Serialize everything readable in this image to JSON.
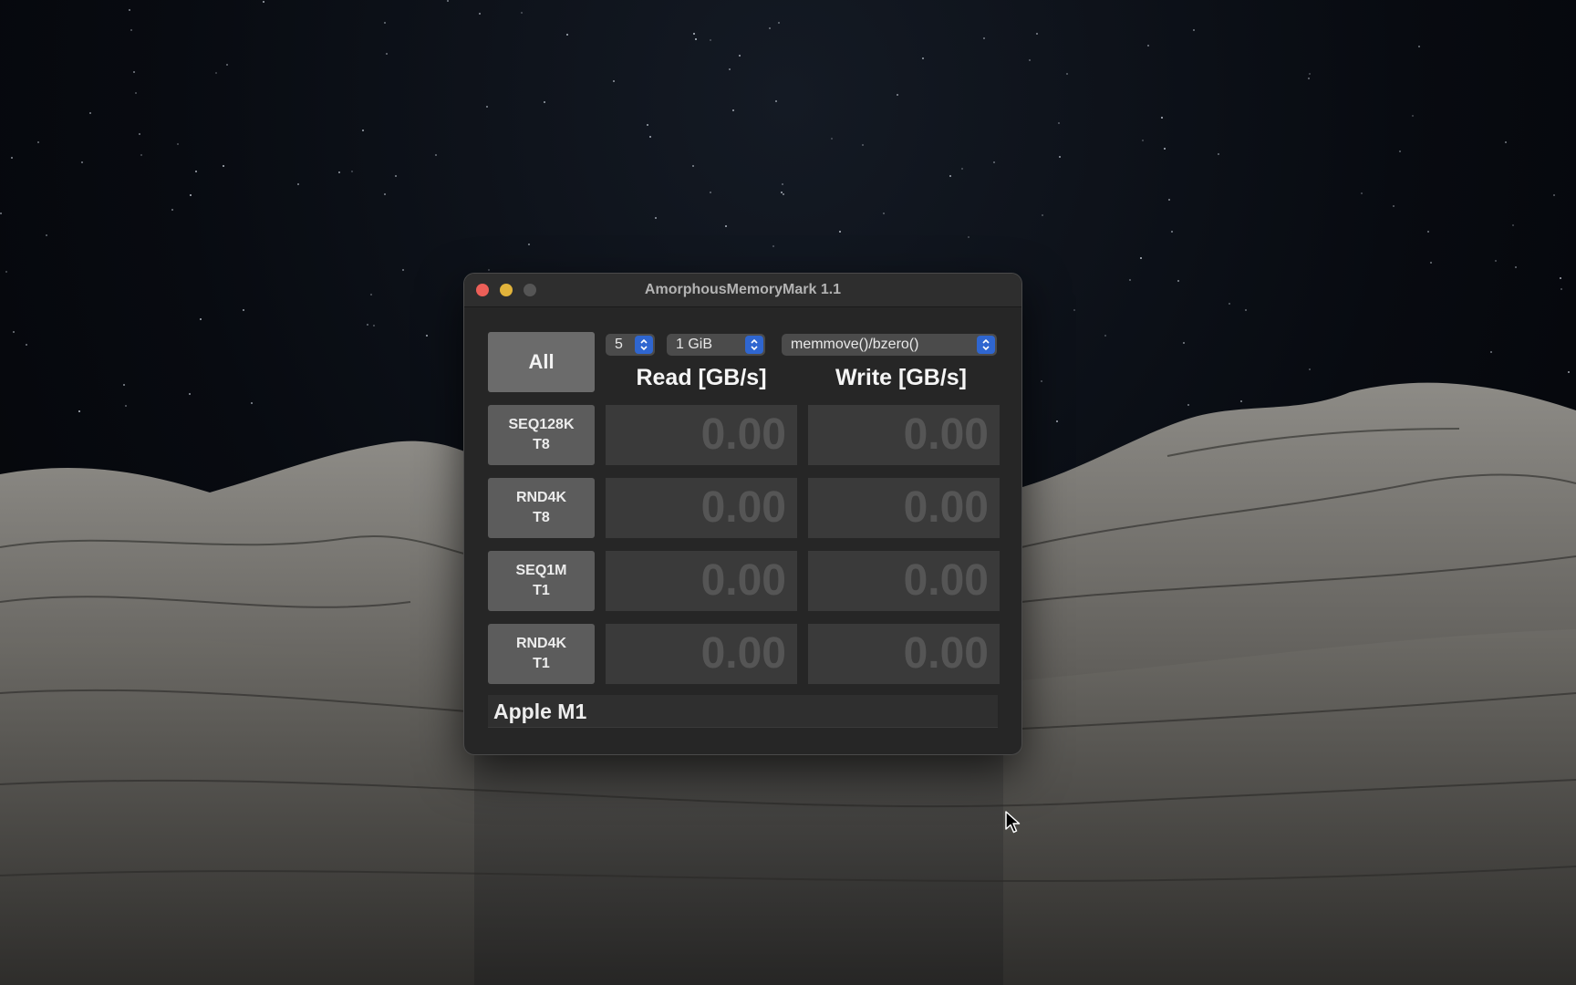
{
  "window": {
    "title": "AmorphousMemoryMark 1.1"
  },
  "controls": {
    "all_button": "All",
    "count_select": "5",
    "size_select": "1 GiB",
    "method_select": "memmove()/bzero()"
  },
  "table": {
    "headers": {
      "read": "Read [GB/s]",
      "write": "Write [GB/s]"
    },
    "rows": [
      {
        "line1": "SEQ128K",
        "line2": "T8",
        "read": "0.00",
        "write": "0.00"
      },
      {
        "line1": "RND4K",
        "line2": "T8",
        "read": "0.00",
        "write": "0.00"
      },
      {
        "line1": "SEQ1M",
        "line2": "T1",
        "read": "0.00",
        "write": "0.00"
      },
      {
        "line1": "RND4K",
        "line2": "T1",
        "read": "0.00",
        "write": "0.00"
      }
    ]
  },
  "status": {
    "chip": "Apple M1"
  },
  "colors": {
    "accent_blue": "#2f66d0",
    "close_red": "#ec5f58",
    "minimize_yellow": "#e1b33b"
  }
}
